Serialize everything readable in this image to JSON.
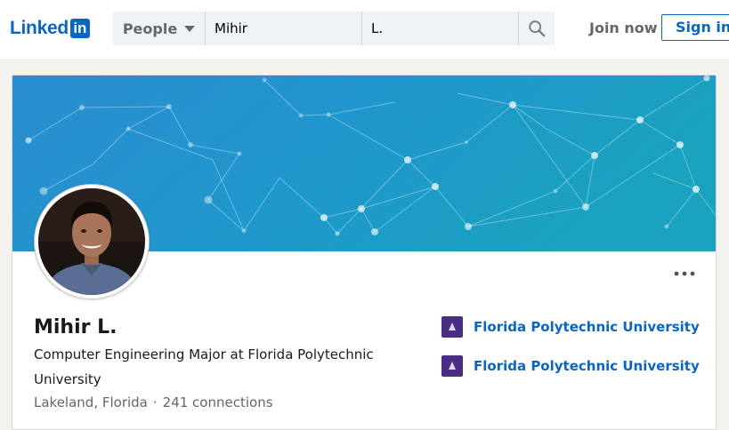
{
  "header": {
    "logo_text": "Linked",
    "logo_badge": "in",
    "search_type": "People",
    "first_name_value": "Mihir",
    "last_name_value": "L.",
    "join_label": "Join now",
    "signin_label": "Sign in"
  },
  "profile": {
    "name": "Mihir L.",
    "headline": "Computer Engineering Major at Florida Polytechnic University",
    "location": "Lakeland, Florida",
    "separator": "·",
    "connections": "241 connections",
    "education": [
      {
        "school": "Florida Polytechnic University"
      },
      {
        "school": "Florida Polytechnic University"
      }
    ]
  },
  "colors": {
    "brand": "#0a66c2",
    "school_logo": "#4b2e83"
  }
}
